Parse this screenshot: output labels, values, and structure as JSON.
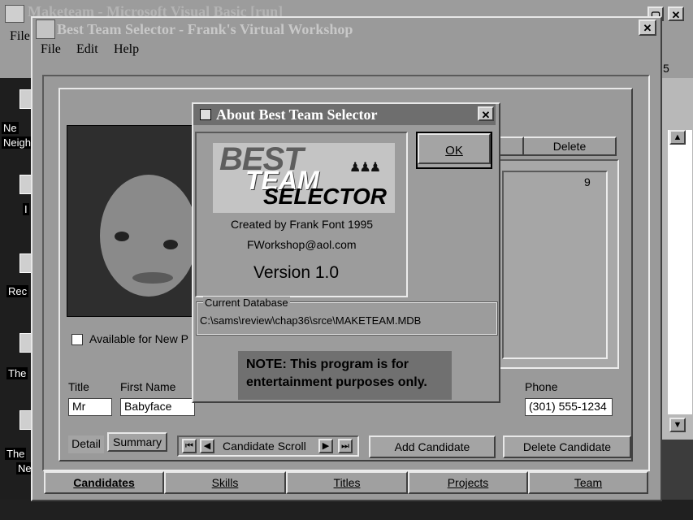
{
  "vb_window": {
    "title": "Maketeam - Microsoft Visual Basic [run]",
    "menu_file": "File",
    "toolbar_fragment": "5"
  },
  "desktop_icons": [
    {
      "label": "Ne"
    },
    {
      "label": "Neigh"
    },
    {
      "label": "I"
    },
    {
      "label": "Rec"
    },
    {
      "label": "The"
    },
    {
      "label": "The"
    },
    {
      "label": "Ne"
    }
  ],
  "main_window": {
    "title": "Best Team Selector - Frank's Virtual Workshop",
    "menu": [
      "File",
      "Edit",
      "Help"
    ],
    "available_checkbox": "Available for New P",
    "fields": {
      "title_label": "Title",
      "title_value": "Mr",
      "first_name_label": "First Name",
      "first_name_value": "Babyface",
      "phone_label": "Phone",
      "phone_value": "(301) 555-1234"
    },
    "list_value": "9",
    "delete_tab": "Delete",
    "detail_tab": "Detail",
    "summary_tab": "Summary",
    "scroll_label": "Candidate Scroll",
    "add_candidate": "Add Candidate",
    "delete_candidate": "Delete Candidate",
    "bottom_tabs": [
      "Candidates",
      "Skills",
      "Titles",
      "Projects",
      "Team"
    ]
  },
  "about_dialog": {
    "title": "About Best Team Selector",
    "logo_best": "BEST",
    "logo_team": "TEAM",
    "logo_selector": "SELECTOR",
    "created_by": "Created by Frank Font 1995",
    "email": "FWorkshop@aol.com",
    "version": "Version 1.0",
    "ok_label": "OK",
    "db_group_label": "Current Database",
    "db_path": "C:\\sams\\review\\chap36\\srce\\MAKETEAM.MDB",
    "note": "NOTE: This program is for entertainment purposes only."
  },
  "colors": {
    "dialog_title_bar": "#6e6e6e",
    "face": "#9a9a9a"
  }
}
